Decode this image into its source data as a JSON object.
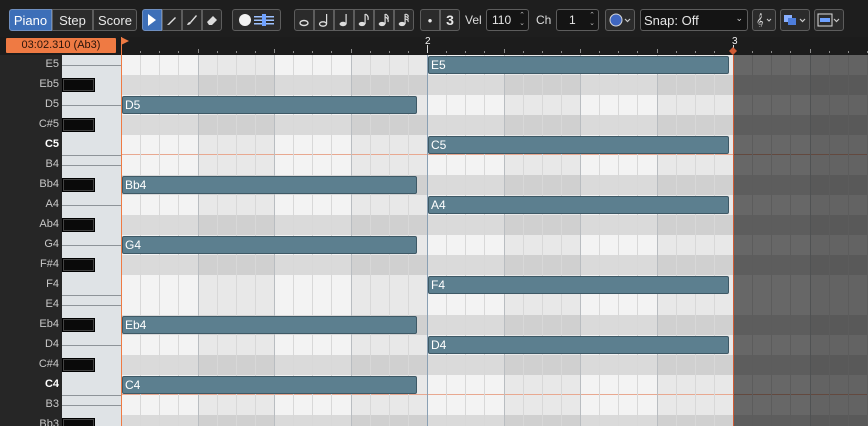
{
  "toolbar": {
    "view_tabs": [
      "Piano",
      "Step",
      "Score"
    ],
    "active_view": "Piano",
    "tools": [
      "select-arrow-icon",
      "pencil-icon",
      "brush-icon",
      "eraser-icon"
    ],
    "record_icons": [
      "record-dot-icon",
      "step-lines-icon"
    ],
    "note_lengths": [
      "whole-note-icon",
      "half-note-icon",
      "quarter-note-icon",
      "eighth-note-icon",
      "sixteenth-note-icon",
      "thirty-second-note-icon"
    ],
    "dot_label": "•",
    "tuplet_value": "3",
    "vel_label": "Vel",
    "vel_value": "110",
    "ch_label": "Ch",
    "ch_value": "1",
    "color_picker": "circle-color-icon",
    "snap_value": "Snap: Off",
    "right_icons": [
      "clef-icon",
      "layer-icon",
      "fit-icon"
    ]
  },
  "ruler": {
    "position": "03:02.310 (Ab3)",
    "bars": [
      "2",
      "3"
    ]
  },
  "keyboard": {
    "keys": [
      "E5",
      "Eb5",
      "D5",
      "C#5",
      "C5",
      "B4",
      "Bb4",
      "A4",
      "Ab4",
      "G4",
      "F#4",
      "F4",
      "E4",
      "Eb4",
      "D4",
      "C#4",
      "C4",
      "B3",
      "Bb3"
    ]
  },
  "notes": [
    {
      "label": "E5",
      "key": "E5",
      "start": 2,
      "length": 0.984
    },
    {
      "label": "D5",
      "key": "D5",
      "start": 1,
      "length": 0.964
    },
    {
      "label": "C5",
      "key": "C5",
      "start": 2,
      "length": 0.984
    },
    {
      "label": "Bb4",
      "key": "Bb4",
      "start": 1,
      "length": 0.964
    },
    {
      "label": "A4",
      "key": "A4",
      "start": 2,
      "length": 0.984
    },
    {
      "label": "G4",
      "key": "G4",
      "start": 1,
      "length": 0.964
    },
    {
      "label": "F4",
      "key": "F4",
      "start": 2,
      "length": 0.984
    },
    {
      "label": "Eb4",
      "key": "Eb4",
      "start": 1,
      "length": 0.964
    },
    {
      "label": "D4",
      "key": "D4",
      "start": 2,
      "length": 0.984
    },
    {
      "label": "C4",
      "key": "C4",
      "start": 1,
      "length": 0.964
    }
  ],
  "colors": {
    "accent": "#3d6fb8",
    "note": "#5c7f8f",
    "position": "#ef7a43"
  }
}
